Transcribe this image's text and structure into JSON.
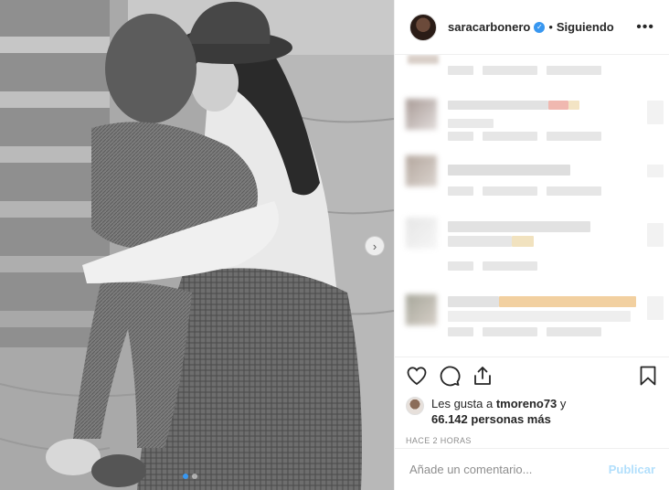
{
  "post": {
    "username": "saracarbonero",
    "separator": "•",
    "follow_status": "Siguiendo",
    "more_glyph": "•••",
    "next_glyph": "›"
  },
  "likes": {
    "prefix": "Les gusta a ",
    "liker": "tmoreno73",
    "conjunction": " y",
    "count": "66.142 personas más"
  },
  "timestamp": "HACE 2 HORAS",
  "comment_box": {
    "placeholder": "Añade un comentario...",
    "publish_label": "Publicar"
  },
  "colors": {
    "accent": "#3897f0",
    "publish_disabled": "#b2dffc",
    "secondary_text": "#8e8e8e",
    "border": "#efefef"
  },
  "icons": [
    "heart-icon",
    "comment-icon",
    "share-icon",
    "bookmark-icon",
    "verified-badge-icon",
    "more-options-icon",
    "next-photo-icon"
  ]
}
